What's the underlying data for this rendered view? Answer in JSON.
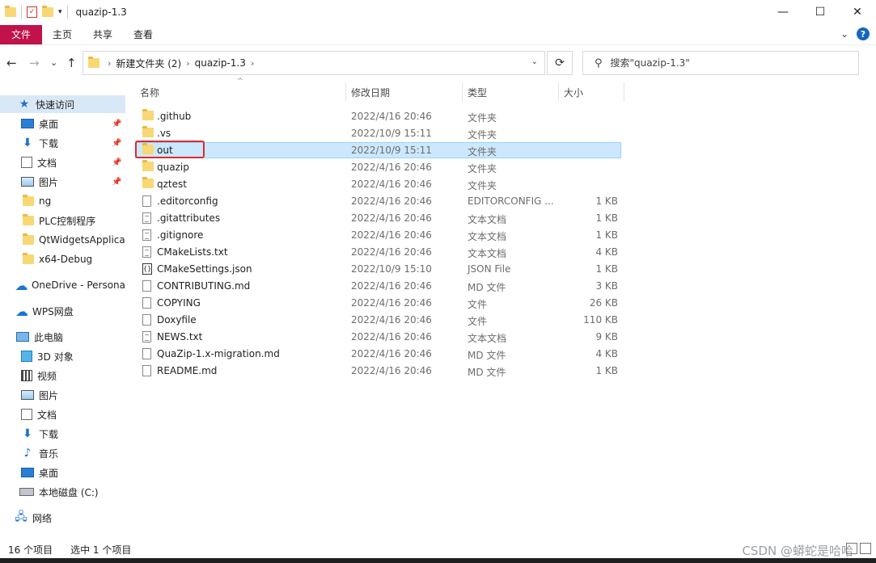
{
  "window": {
    "title": "quazip-1.3",
    "minimize_glyph": "—",
    "maximize_glyph": "☐",
    "close_glyph": "✕"
  },
  "ribbon": {
    "tabs": [
      "文件",
      "主页",
      "共享",
      "查看"
    ],
    "expand_glyph": "⌄",
    "help_glyph": "?"
  },
  "nav": {
    "back_glyph": "←",
    "forward_glyph": "→",
    "recent_glyph": "⌄",
    "up_glyph": "↑",
    "breadcrumbs": [
      "新建文件夹 (2)",
      "quazip-1.3"
    ],
    "refresh_glyph": "⟳",
    "search_placeholder": "搜索\"quazip-1.3\""
  },
  "sidebar": {
    "items": [
      {
        "label": "快速访问",
        "icon": "star-icon"
      },
      {
        "label": "桌面",
        "icon": "desktop-icon",
        "pinned": true
      },
      {
        "label": "下载",
        "icon": "download-icon",
        "pinned": true
      },
      {
        "label": "文档",
        "icon": "documents-icon",
        "pinned": true
      },
      {
        "label": "图片",
        "icon": "pictures-icon",
        "pinned": true
      },
      {
        "label": "ng",
        "icon": "folder-icon"
      },
      {
        "label": "PLC控制程序",
        "icon": "folder-icon"
      },
      {
        "label": "QtWidgetsApplica",
        "icon": "folder-icon"
      },
      {
        "label": "x64-Debug",
        "icon": "folder-icon"
      },
      {
        "label": "OneDrive - Persona",
        "icon": "onedrive-icon"
      },
      {
        "label": "WPS网盘",
        "icon": "cloud-icon"
      },
      {
        "label": "此电脑",
        "icon": "this-pc-icon"
      },
      {
        "label": "3D 对象",
        "icon": "3d-objects-icon"
      },
      {
        "label": "视频",
        "icon": "videos-icon"
      },
      {
        "label": "图片",
        "icon": "pictures-icon"
      },
      {
        "label": "文档",
        "icon": "documents-icon"
      },
      {
        "label": "下载",
        "icon": "download-icon"
      },
      {
        "label": "音乐",
        "icon": "music-icon"
      },
      {
        "label": "桌面",
        "icon": "desktop-icon"
      },
      {
        "label": "本地磁盘 (C:)",
        "icon": "drive-icon"
      },
      {
        "label": "网络",
        "icon": "network-icon"
      }
    ],
    "pin_glyph": "📌"
  },
  "columns": {
    "name": "名称",
    "date": "修改日期",
    "type": "类型",
    "size": "大小",
    "sort_glyph": "^"
  },
  "files": [
    {
      "name": ".github",
      "date": "2022/4/16 20:46",
      "type": "文件夹",
      "size": "",
      "icon": "folder-icon"
    },
    {
      "name": ".vs",
      "date": "2022/10/9 15:11",
      "type": "文件夹",
      "size": "",
      "icon": "folder-icon"
    },
    {
      "name": "out",
      "date": "2022/10/9 15:11",
      "type": "文件夹",
      "size": "",
      "icon": "folder-icon",
      "selected": true
    },
    {
      "name": "quazip",
      "date": "2022/4/16 20:46",
      "type": "文件夹",
      "size": "",
      "icon": "folder-icon"
    },
    {
      "name": "qztest",
      "date": "2022/4/16 20:46",
      "type": "文件夹",
      "size": "",
      "icon": "folder-icon"
    },
    {
      "name": ".editorconfig",
      "date": "2022/4/16 20:46",
      "type": "EDITORCONFIG ...",
      "size": "1 KB",
      "icon": "file-icon"
    },
    {
      "name": ".gitattributes",
      "date": "2022/4/16 20:46",
      "type": "文本文档",
      "size": "1 KB",
      "icon": "text-file-icon"
    },
    {
      "name": ".gitignore",
      "date": "2022/4/16 20:46",
      "type": "文本文档",
      "size": "1 KB",
      "icon": "text-file-icon"
    },
    {
      "name": "CMakeLists.txt",
      "date": "2022/4/16 20:46",
      "type": "文本文档",
      "size": "4 KB",
      "icon": "text-file-icon"
    },
    {
      "name": "CMakeSettings.json",
      "date": "2022/10/9 15:10",
      "type": "JSON File",
      "size": "1 KB",
      "icon": "json-file-icon"
    },
    {
      "name": "CONTRIBUTING.md",
      "date": "2022/4/16 20:46",
      "type": "MD 文件",
      "size": "3 KB",
      "icon": "file-icon"
    },
    {
      "name": "COPYING",
      "date": "2022/4/16 20:46",
      "type": "文件",
      "size": "26 KB",
      "icon": "file-icon"
    },
    {
      "name": "Doxyfile",
      "date": "2022/4/16 20:46",
      "type": "文件",
      "size": "110 KB",
      "icon": "file-icon"
    },
    {
      "name": "NEWS.txt",
      "date": "2022/4/16 20:46",
      "type": "文本文档",
      "size": "9 KB",
      "icon": "text-file-icon"
    },
    {
      "name": "QuaZip-1.x-migration.md",
      "date": "2022/4/16 20:46",
      "type": "MD 文件",
      "size": "4 KB",
      "icon": "file-icon"
    },
    {
      "name": "README.md",
      "date": "2022/4/16 20:46",
      "type": "MD 文件",
      "size": "1 KB",
      "icon": "file-icon"
    }
  ],
  "status": {
    "count": "16 个项目",
    "selected": "选中 1 个项目"
  },
  "watermark": "CSDN @蟒蛇是哈哈",
  "colors": {
    "file_tab": "#c1124b",
    "selection_bg": "#cce8ff",
    "highlight_box": "#e02a2a"
  }
}
